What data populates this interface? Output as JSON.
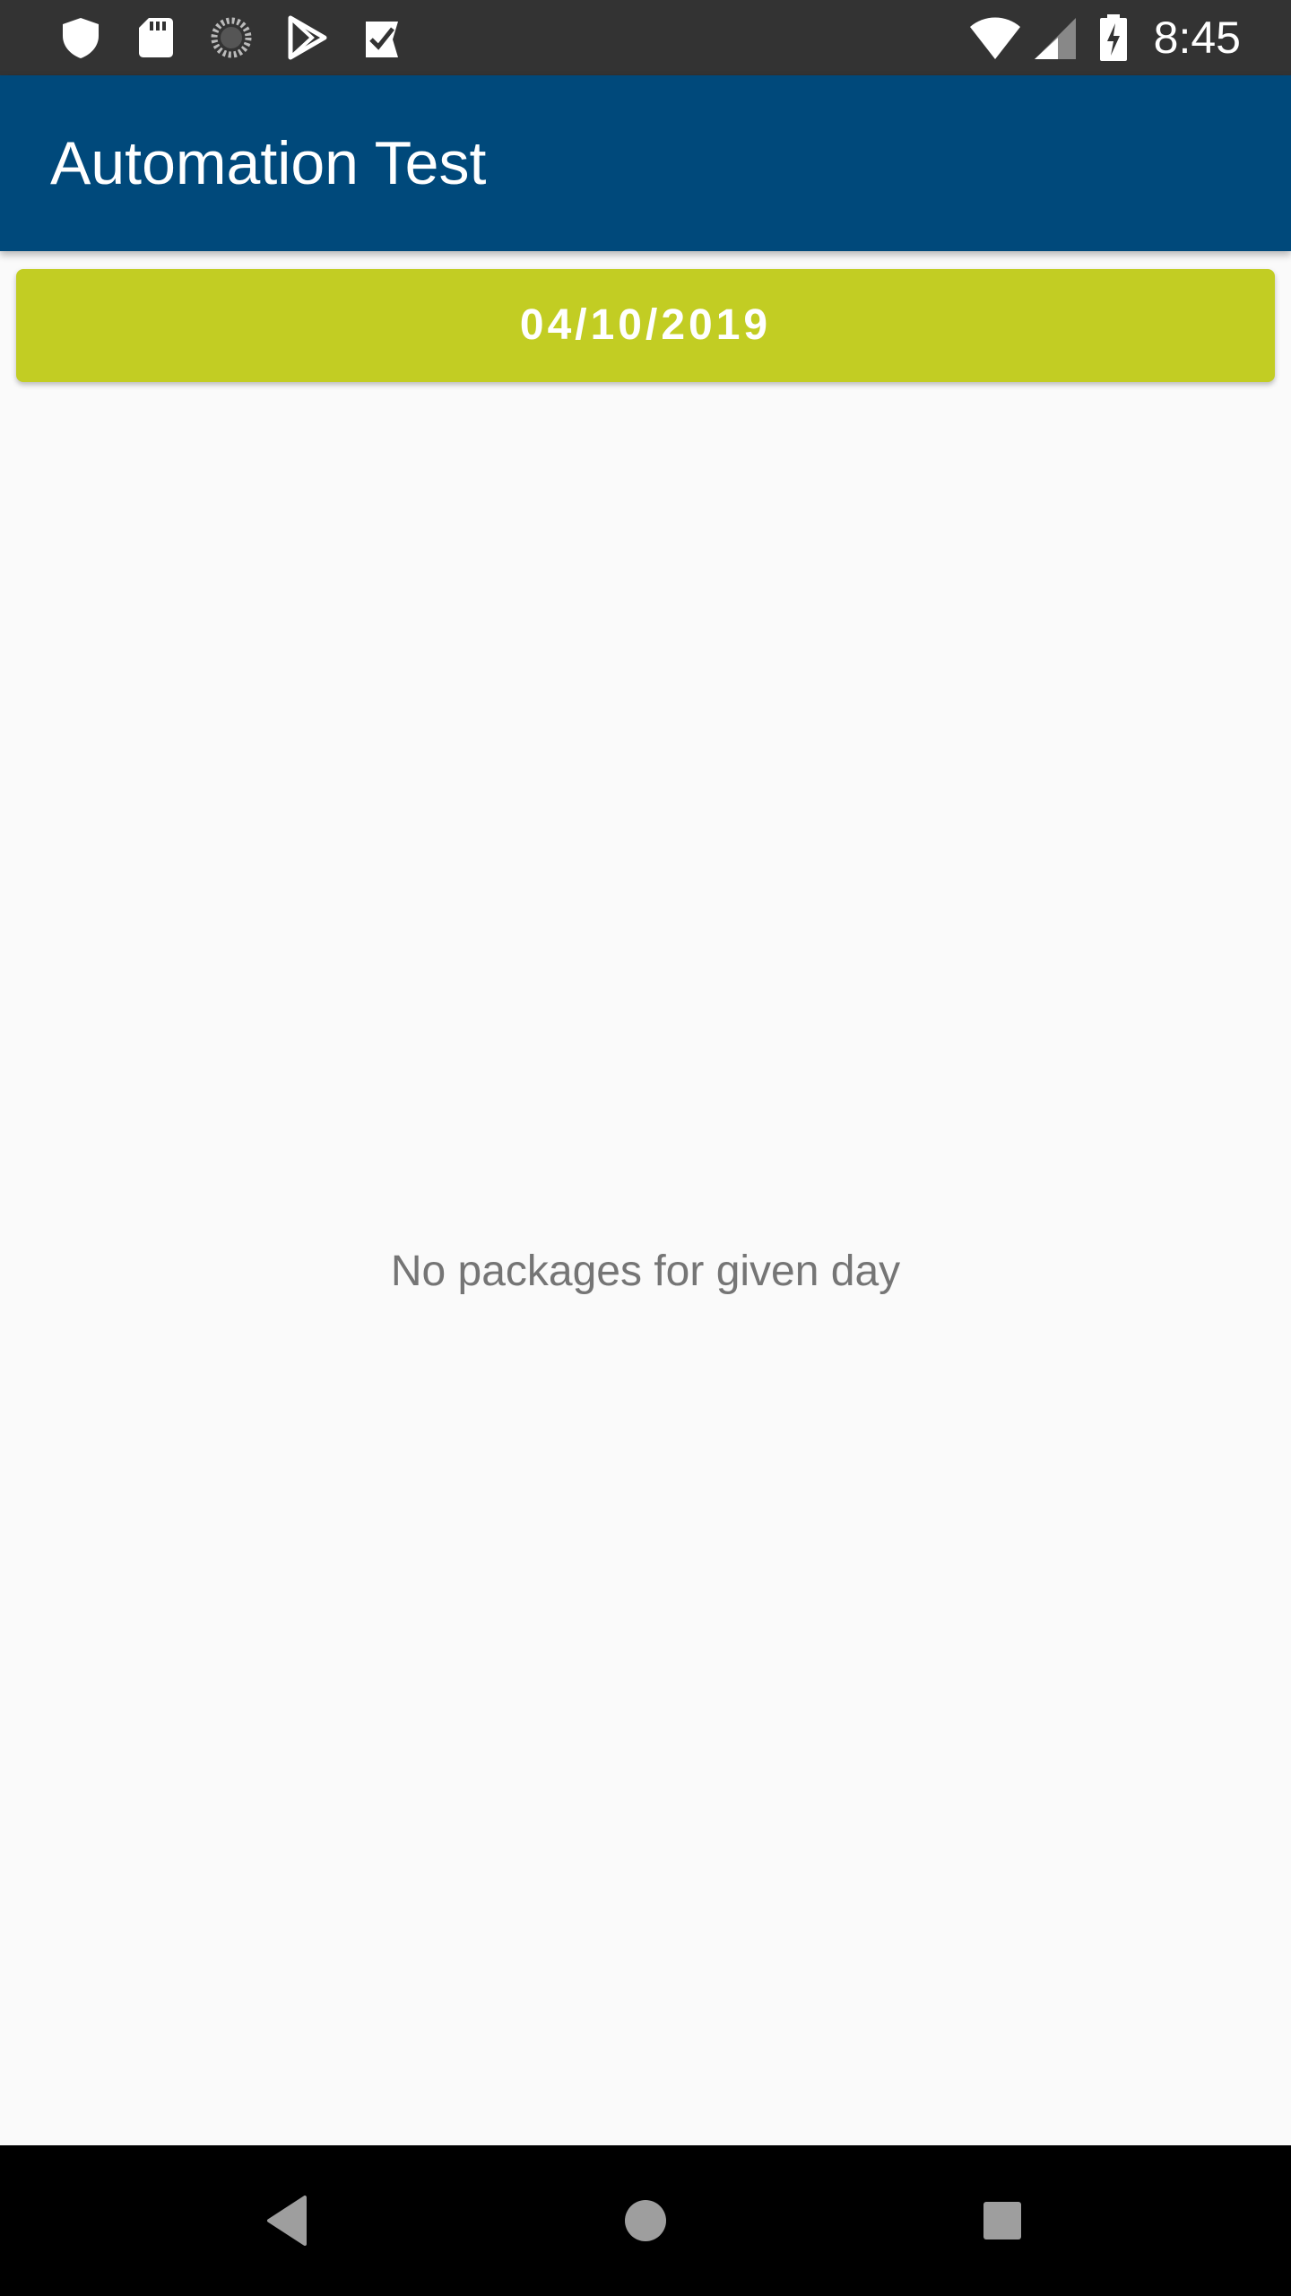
{
  "status_bar": {
    "time": "8:45",
    "left_icons": [
      "shield-icon",
      "sd-card-icon",
      "sync-spinner-icon",
      "play-store-icon",
      "task-check-icon"
    ],
    "right_icons": [
      "wifi-icon",
      "signal-icon",
      "battery-charging-icon"
    ]
  },
  "app_bar": {
    "title": "Automation Test",
    "background": "#00497b"
  },
  "date_button": {
    "label": "04/10/2019",
    "background": "#c2cd23"
  },
  "content": {
    "empty_message": "No packages for given day"
  },
  "nav_bar": {
    "buttons": [
      "back-icon",
      "home-icon",
      "recents-icon"
    ]
  }
}
